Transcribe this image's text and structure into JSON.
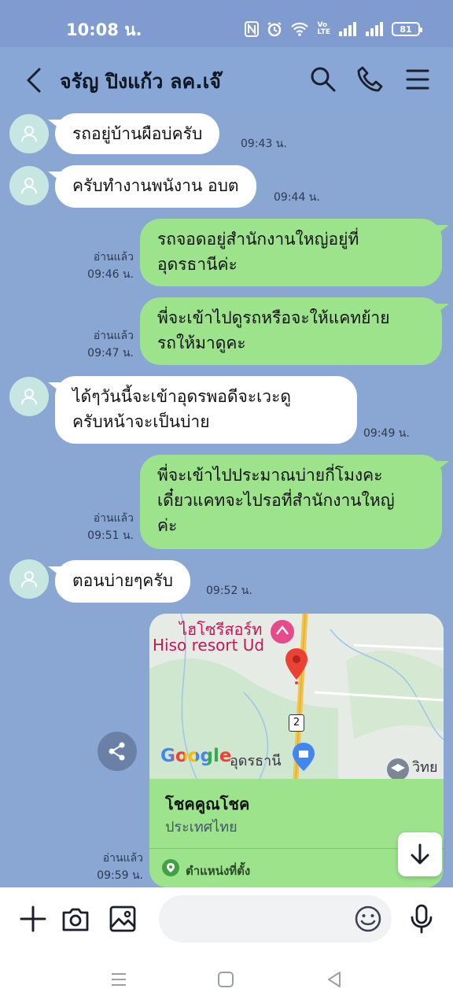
{
  "status": {
    "time": "10:08 น.",
    "battery": "81",
    "volte": "Vo\nLTE"
  },
  "header": {
    "title": "จรัญ ปิงแก้ว ลค.เจ๊"
  },
  "messages": [
    {
      "text": "รถอยู่บ้านผือบ่ครับ",
      "time": "09:43 น."
    },
    {
      "text": "ครับทำงานพนังาน อบต",
      "time": "09:44 น."
    },
    {
      "text_l1": "รถจอดอยู่สำนักงานใหญ่อยู่ที่",
      "text_l2": "อุดรธานีค่ะ",
      "read": "อ่านแล้ว",
      "time": "09:46 น."
    },
    {
      "text_l1": "พี่จะเข้าไปดูรถหรือจะให้แคทย้าย",
      "text_l2": "รถให้มาดูคะ",
      "read": "อ่านแล้ว",
      "time": "09:47 น."
    },
    {
      "text_l1": "ได้ๆวันนี้จะเข้าอุดรพอดีจะเวะดู",
      "text_l2": "ครับหน้าจะเป็นบ่าย",
      "time": "09:49 น."
    },
    {
      "text_l1": "พี่จะเข้าไปประมาณบ่ายกี่โมงคะ",
      "text_l2": "เดี๋ยวแคทจะไปรอที่สำนักงานใหญ่",
      "text_l3": "ค่ะ",
      "read": "อ่านแล้ว",
      "time": "09:51 น."
    },
    {
      "text": "ตอนบ่ายๆครับ",
      "time": "09:52 น."
    }
  ],
  "location_card": {
    "map_label_th": "ไฮโซรีสอร์ท",
    "map_label_en": "Hiso resort Ud",
    "map_brand": "Google",
    "map_city": "อุดรธานี",
    "map_city2": "วิทย",
    "map_road": "2",
    "place_name": "โชคคูณโชค",
    "country": "ประเทศไทย",
    "link_label": "ตำแหน่งที่ตั้ง",
    "read": "อ่านแล้ว",
    "time": "09:59 น."
  },
  "input": {
    "placeholder": ""
  },
  "colors": {
    "background": "#8aa6d3",
    "outgoing": "#9de38c",
    "incoming": "#ffffff"
  }
}
